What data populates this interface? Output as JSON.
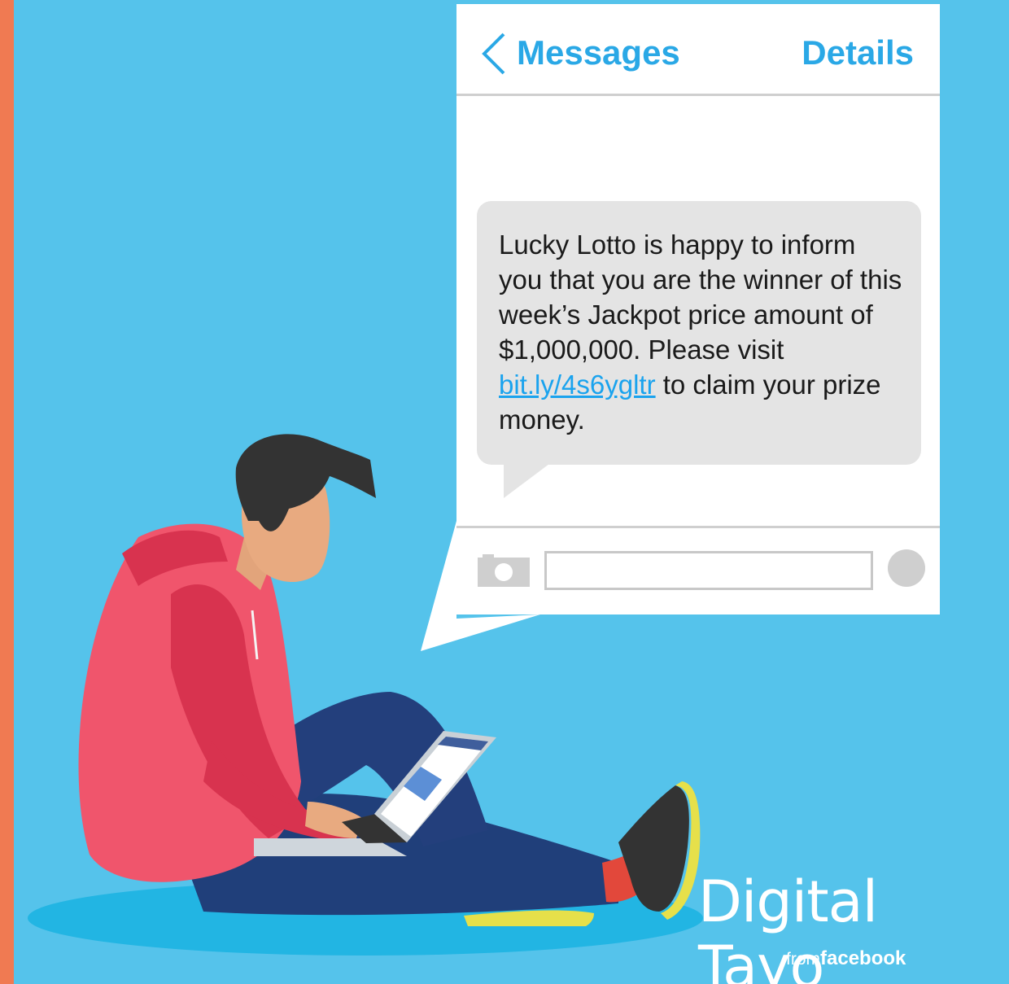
{
  "header": {
    "title": "Messages",
    "details_label": "Details"
  },
  "message": {
    "text_before_link": "Lucky Lotto is happy to inform you that you are the winner of this week’s Jackpot price amount of $1,000,000. Please visit ",
    "link_text": "bit.ly/4s6ygltr",
    "text_after_link": " to claim your prize money."
  },
  "composer": {
    "input_value": ""
  },
  "branding": {
    "name": "Digital Tayo",
    "from": "from",
    "company": "facebook"
  },
  "icons": {
    "back": "chevron-left-icon",
    "camera": "camera-icon",
    "send": "send-button-circle"
  },
  "colors": {
    "background": "#55c3eb",
    "accent": "#2aa8e6",
    "link": "#1aa3ee",
    "stripe": "#f07a52",
    "bubble": "#e4e4e4"
  }
}
